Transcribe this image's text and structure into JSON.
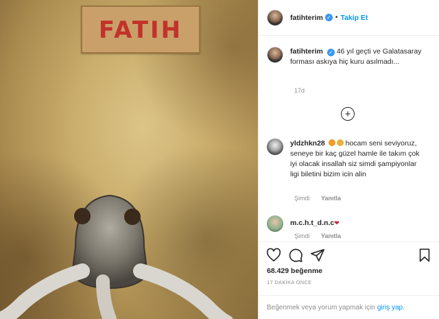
{
  "photo": {
    "label_text": "FATIH"
  },
  "header": {
    "username": "fatihterim",
    "verified": true,
    "follow_label": "Takip Et",
    "separator": "•"
  },
  "caption": {
    "username": "fatihterim",
    "text": "46 yıl geçti ve Galatasaray forması askıya hiç kuru asılmadı...",
    "age": "17d"
  },
  "comments": [
    {
      "username": "yldzhkn28",
      "emojis": [
        "fire-emoji",
        "lion-emoji"
      ],
      "text": "hocam seni seviyoruz, seneye bir kaç güzel hamle ile takım çok iyi olacak insallah siz simdi şampiyonlar ligi biletini bizim icin alin",
      "time": "Şimdi",
      "reply_label": "Yanıtla"
    },
    {
      "username": "m.c.h.t_d.n.c",
      "emojis": [
        "heart-emoji"
      ],
      "text": "",
      "time": "Şimdi",
      "reply_label": "Yanıtla"
    }
  ],
  "actions": {
    "icons": [
      "heart-icon",
      "comment-icon",
      "share-icon",
      "bookmark-icon"
    ]
  },
  "stats": {
    "likes": "68.429 beğenme",
    "timestamp": "17 DAKİKA ÖNCE"
  },
  "footer": {
    "prompt": "Beğenmek veya yorum yapmak için",
    "login_link": "giriş yap."
  },
  "colors": {
    "accent": "#0095f6",
    "verified": "#3897f0",
    "label_red": "#c2322a"
  }
}
